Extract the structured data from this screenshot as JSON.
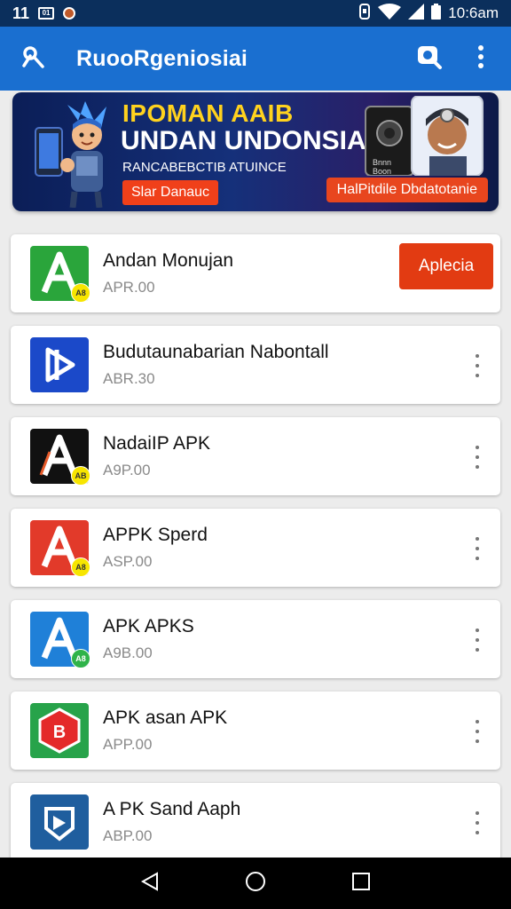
{
  "status_bar": {
    "left_text": "11",
    "mini_icon_text": "01",
    "time": "10:6am"
  },
  "app_bar": {
    "title": "RuooRgeniosiai"
  },
  "banner": {
    "headline": "IPOMAN AAIB",
    "subheadline": "UNDAN UNDONSIAI",
    "tagline": "RANCABEBCTIB ATUINCE",
    "left_button": "Slar Danauc",
    "right_button": "HalPitdile Dbdatotanie",
    "phone_screen_text": "Bnnn Boon"
  },
  "apps": [
    {
      "name": "Andan Monujan",
      "size": "APR.00",
      "action": "install",
      "install_label": "Aplecia",
      "icon_color": "#2aa53b",
      "icon_glyph": "A",
      "badge": "A8"
    },
    {
      "name": "Budutaunabarian Nabontall",
      "size": "ABR.30",
      "action": "menu",
      "icon_color": "#1b49c9",
      "icon_glyph": "D",
      "badge": ""
    },
    {
      "name": "NadaiIP APK",
      "size": "A9P.00",
      "action": "menu",
      "icon_color": "#111111",
      "icon_glyph": "A",
      "badge": "AB"
    },
    {
      "name": "APPK Sperd",
      "size": "ASP.00",
      "action": "menu",
      "icon_color": "#e23a2a",
      "icon_glyph": "A",
      "badge": "A8"
    },
    {
      "name": "APK APKS",
      "size": "A9B.00",
      "action": "menu",
      "icon_color": "#1f80d8",
      "icon_glyph": "A",
      "badge": "A8"
    },
    {
      "name": "APK asan APK",
      "size": "APP.00",
      "action": "menu",
      "icon_color": "#27a34a",
      "icon_glyph": "B",
      "badge": ""
    },
    {
      "name": "A PK Sand Aaph",
      "size": "ABP.00",
      "action": "menu",
      "icon_color": "#1f5e9e",
      "icon_glyph": "G",
      "badge": ""
    }
  ],
  "colors": {
    "status_bar": "#0b2f5c",
    "app_bar": "#1a6fd0",
    "install_button": "#e23b12",
    "background": "#ececec"
  }
}
